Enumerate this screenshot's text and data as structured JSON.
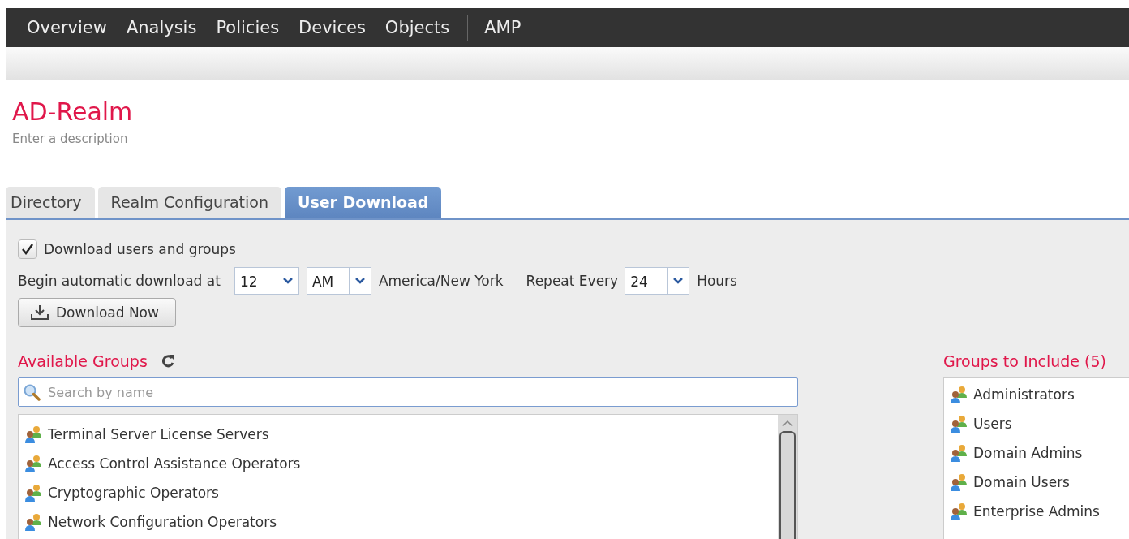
{
  "nav": {
    "items": [
      {
        "label": "Overview"
      },
      {
        "label": "Analysis"
      },
      {
        "label": "Policies"
      },
      {
        "label": "Devices"
      },
      {
        "label": "Objects"
      },
      {
        "label": "AMP",
        "separated": true
      }
    ]
  },
  "title": "AD-Realm",
  "description": "Enter a description",
  "tabs": [
    {
      "label": "Directory",
      "selected": false
    },
    {
      "label": "Realm Configuration",
      "selected": false
    },
    {
      "label": "User Download",
      "selected": true
    }
  ],
  "download_checkbox": {
    "label": "Download users and groups",
    "checked": true
  },
  "schedule": {
    "label": "Begin automatic download at",
    "hour": "12",
    "ampm": "AM",
    "timezone": "America/New York",
    "repeat_label": "Repeat Every",
    "repeat": "24",
    "unit": "Hours"
  },
  "download_button": "Download Now",
  "available_groups": {
    "title": "Available Groups",
    "search": {
      "placeholder": "Search by name"
    },
    "items": [
      {
        "label": "Terminal Server License Servers"
      },
      {
        "label": "Access Control Assistance Operators"
      },
      {
        "label": "Cryptographic Operators"
      },
      {
        "label": "Network Configuration Operators"
      }
    ]
  },
  "groups_to_include": {
    "title": "Groups to Include (5)",
    "items": [
      {
        "label": "Administrators"
      },
      {
        "label": "Users"
      },
      {
        "label": "Domain Admins"
      },
      {
        "label": "Domain Users"
      },
      {
        "label": "Enterprise Admins"
      }
    ]
  }
}
